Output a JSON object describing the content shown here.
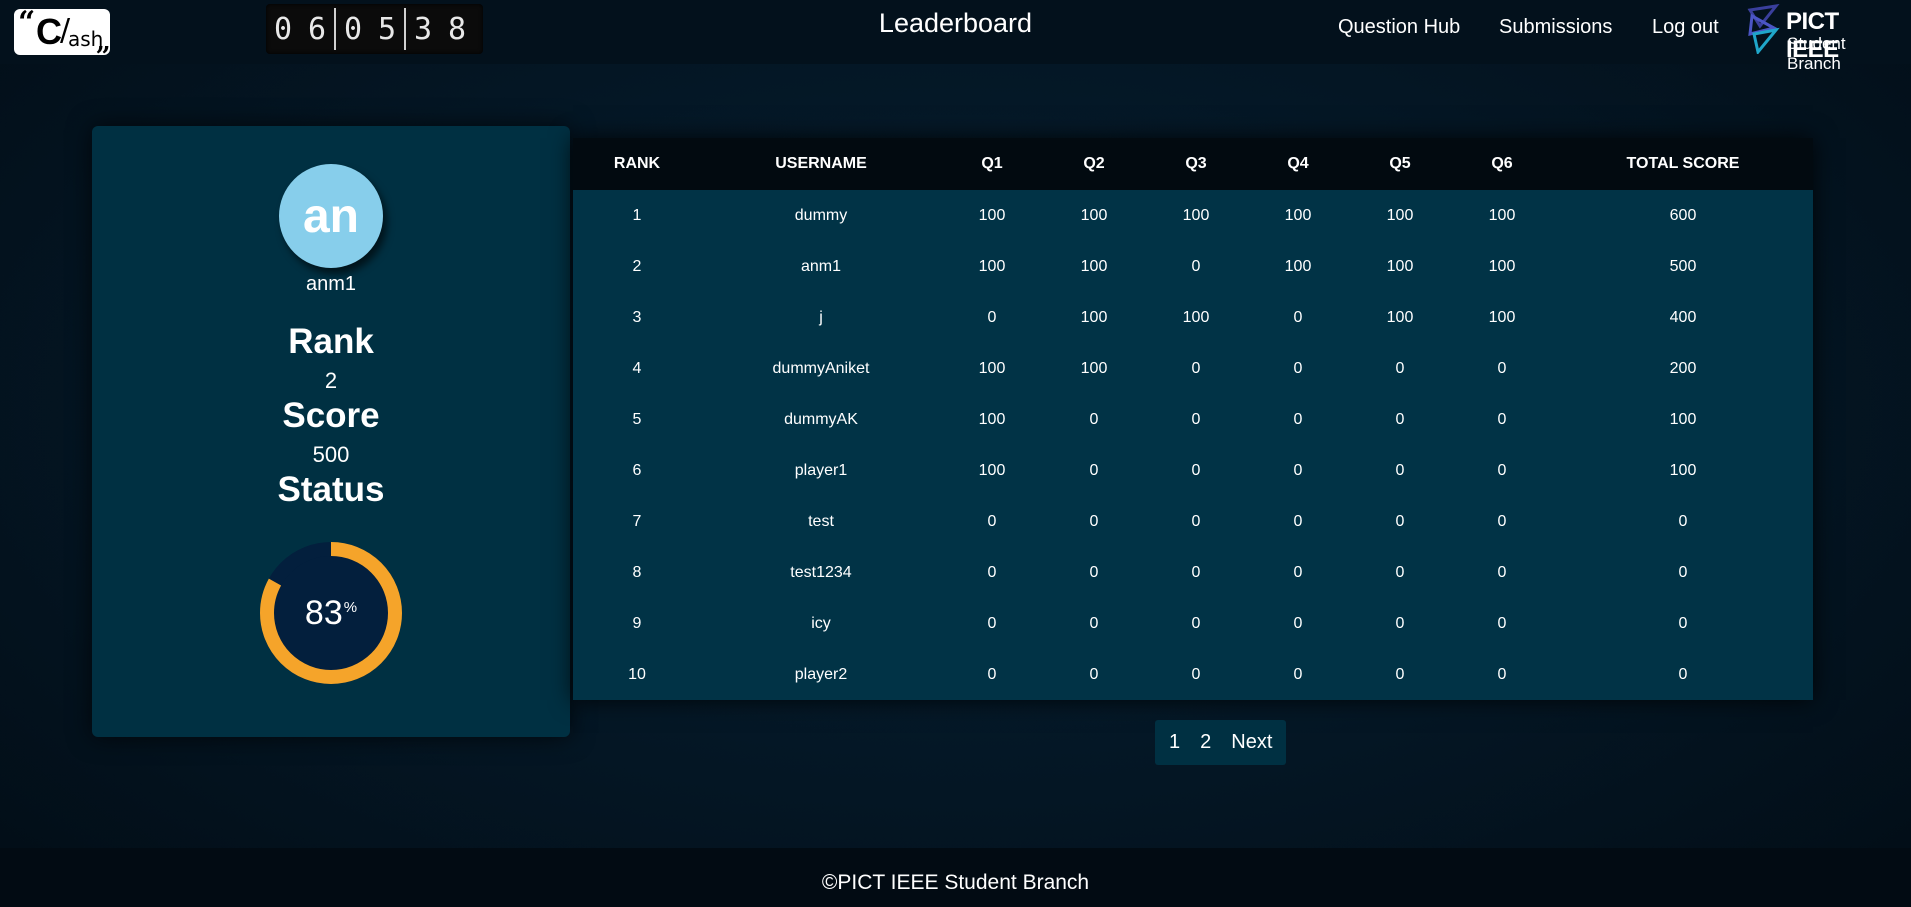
{
  "header": {
    "logo": {
      "open_quote": "“",
      "letter": "C",
      "slash": "/",
      "sub": "ash",
      "close_quote": "„"
    },
    "timer": {
      "digits": [
        "0",
        "6",
        "0",
        "5",
        "3",
        "8"
      ]
    },
    "title": "Leaderboard",
    "nav": {
      "question_hub": "Question Hub",
      "submissions": "Submissions",
      "logout": "Log out"
    },
    "ieee": {
      "line1": "PICT IEEE",
      "line2": "Student Branch"
    }
  },
  "profile": {
    "initials": "an",
    "username": "anm1",
    "rank_label": "Rank",
    "rank_value": "2",
    "score_label": "Score",
    "score_value": "500",
    "status_label": "Status",
    "status_percent": 83,
    "status_text": "83",
    "status_unit": "%",
    "colors": {
      "ring": "#f5a42a",
      "ring_inner": "#031f3d",
      "avatar": "#87ceeb"
    }
  },
  "leaderboard": {
    "columns": [
      "RANK",
      "USERNAME",
      "Q1",
      "Q2",
      "Q3",
      "Q4",
      "Q5",
      "Q6",
      "TOTAL SCORE"
    ],
    "rows": [
      [
        "1",
        "dummy",
        "100",
        "100",
        "100",
        "100",
        "100",
        "100",
        "600"
      ],
      [
        "2",
        "anm1",
        "100",
        "100",
        "0",
        "100",
        "100",
        "100",
        "500"
      ],
      [
        "3",
        "j",
        "0",
        "100",
        "100",
        "0",
        "100",
        "100",
        "400"
      ],
      [
        "4",
        "dummyAniket",
        "100",
        "100",
        "0",
        "0",
        "0",
        "0",
        "200"
      ],
      [
        "5",
        "dummyAK",
        "100",
        "0",
        "0",
        "0",
        "0",
        "0",
        "100"
      ],
      [
        "6",
        "player1",
        "100",
        "0",
        "0",
        "0",
        "0",
        "0",
        "100"
      ],
      [
        "7",
        "test",
        "0",
        "0",
        "0",
        "0",
        "0",
        "0",
        "0"
      ],
      [
        "8",
        "test1234",
        "0",
        "0",
        "0",
        "0",
        "0",
        "0",
        "0"
      ],
      [
        "9",
        "icy",
        "0",
        "0",
        "0",
        "0",
        "0",
        "0",
        "0"
      ],
      [
        "10",
        "player2",
        "0",
        "0",
        "0",
        "0",
        "0",
        "0",
        "0"
      ]
    ]
  },
  "pagination": {
    "pages": [
      "1",
      "2"
    ],
    "next": "Next"
  },
  "footer": {
    "text": "©PICT IEEE Student Branch"
  }
}
